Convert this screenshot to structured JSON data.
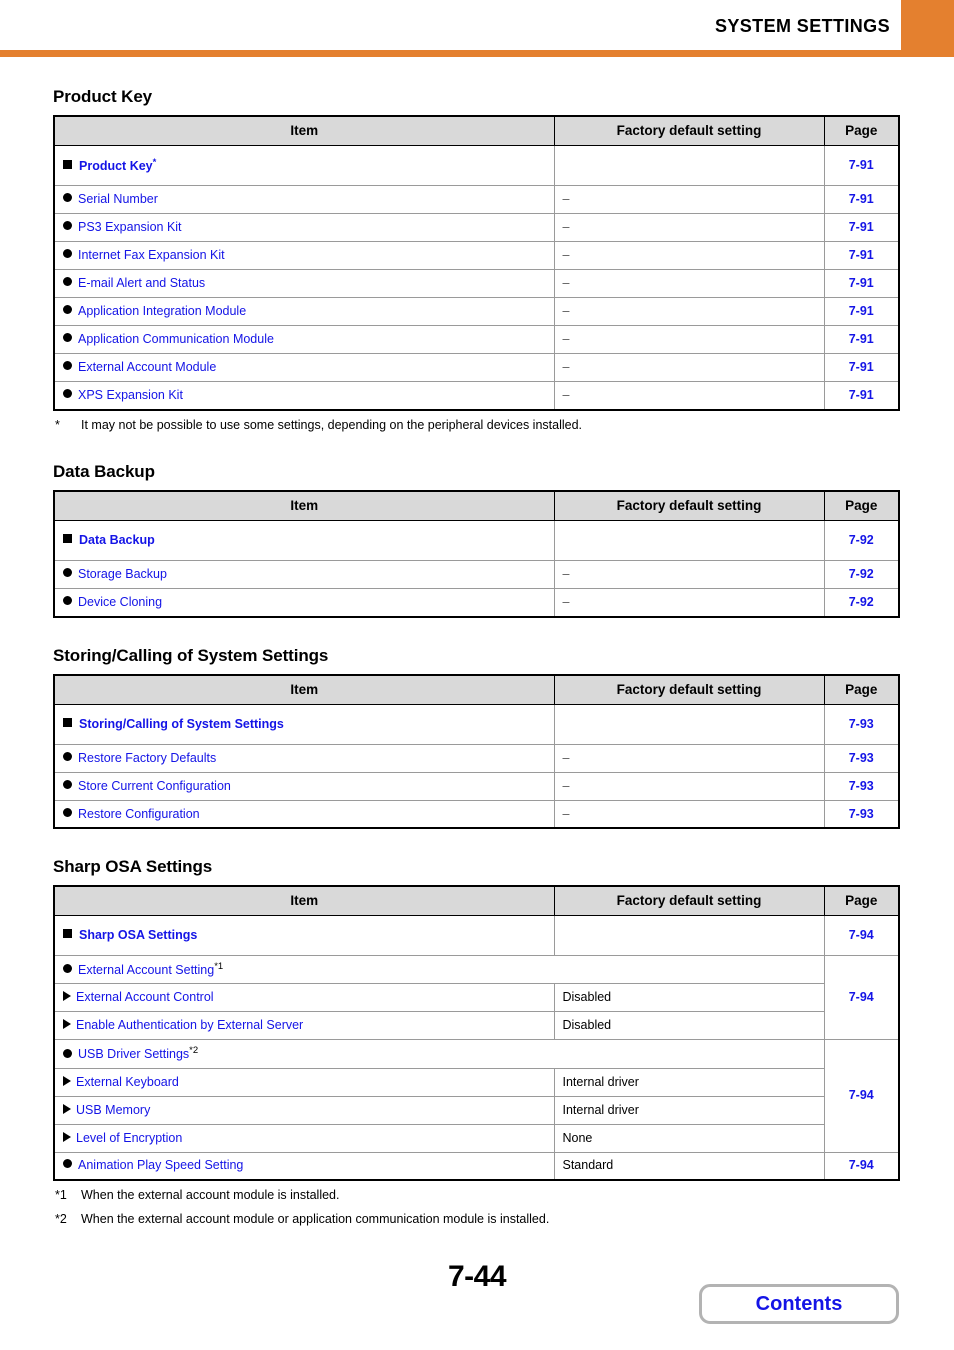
{
  "header": {
    "title": "SYSTEM SETTINGS",
    "accent_color": "#e4802f"
  },
  "link_color": "#1414e6",
  "columns": {
    "item": "Item",
    "factory": "Factory default setting",
    "page": "Page"
  },
  "sections": [
    {
      "heading": "Product Key",
      "rows": [
        {
          "level": 1,
          "label": "Product Key",
          "sup": "*",
          "factory": "",
          "page": "7-91"
        },
        {
          "level": 2,
          "label": "Serial Number",
          "factory": "–",
          "page": "7-91"
        },
        {
          "level": 2,
          "label": "PS3 Expansion Kit",
          "factory": "–",
          "page": "7-91"
        },
        {
          "level": 2,
          "label": "Internet Fax Expansion Kit",
          "factory": "–",
          "page": "7-91"
        },
        {
          "level": 2,
          "label": "E-mail Alert and Status",
          "factory": "–",
          "page": "7-91"
        },
        {
          "level": 2,
          "label": "Application Integration Module",
          "factory": "–",
          "page": "7-91"
        },
        {
          "level": 2,
          "label": "Application Communication Module",
          "factory": "–",
          "page": "7-91"
        },
        {
          "level": 2,
          "label": "External Account Module",
          "factory": "–",
          "page": "7-91"
        },
        {
          "level": 2,
          "label": "XPS Expansion Kit",
          "factory": "–",
          "page": "7-91"
        }
      ],
      "footnotes": [
        {
          "mark": "*",
          "text": "It may not be possible to use some settings, depending on the peripheral devices installed."
        }
      ]
    },
    {
      "heading": "Data Backup",
      "rows": [
        {
          "level": 1,
          "label": "Data Backup",
          "factory": "",
          "page": "7-92"
        },
        {
          "level": 2,
          "label": "Storage Backup",
          "factory": "–",
          "page": "7-92"
        },
        {
          "level": 2,
          "label": "Device Cloning",
          "factory": "–",
          "page": "7-92"
        }
      ],
      "footnotes": []
    },
    {
      "heading": "Storing/Calling of System Settings",
      "rows": [
        {
          "level": 1,
          "label": "Storing/Calling of System Settings",
          "factory": "",
          "page": "7-93"
        },
        {
          "level": 2,
          "label": "Restore Factory Defaults",
          "factory": "–",
          "page": "7-93"
        },
        {
          "level": 2,
          "label": "Store Current Configuration",
          "factory": "–",
          "page": "7-93"
        },
        {
          "level": 2,
          "label": "Restore Configuration",
          "factory": "–",
          "page": "7-93"
        }
      ],
      "footnotes": []
    },
    {
      "heading": "Sharp OSA Settings",
      "rows": [
        {
          "level": 1,
          "label": "Sharp OSA Settings",
          "factory": "",
          "page": "7-94"
        },
        {
          "level": 2,
          "label": "External Account Setting",
          "sup": "*1",
          "span": true,
          "page": "7-94",
          "page_rowspan": 3
        },
        {
          "level": 3,
          "label": "External Account Control",
          "factory": "Disabled"
        },
        {
          "level": 3,
          "label": "Enable Authentication by External Server",
          "factory": "Disabled"
        },
        {
          "level": 2,
          "label": "USB Driver Settings",
          "sup": "*2",
          "span": true,
          "page": "7-94",
          "page_rowspan": 4
        },
        {
          "level": 3,
          "label": "External Keyboard",
          "factory": "Internal driver"
        },
        {
          "level": 3,
          "label": "USB Memory",
          "factory": "Internal driver"
        },
        {
          "level": 3,
          "label": "Level of Encryption",
          "factory": "None"
        },
        {
          "level": 2,
          "label": "Animation Play Speed Setting",
          "factory": "Standard",
          "page": "7-94"
        }
      ],
      "footnotes": [
        {
          "mark": "*1",
          "text": "When the external account module is installed."
        },
        {
          "mark": "*2",
          "text": "When the external account module or application communication module is installed."
        }
      ]
    }
  ],
  "footer": {
    "page_number": "7-44",
    "contents_label": "Contents"
  }
}
